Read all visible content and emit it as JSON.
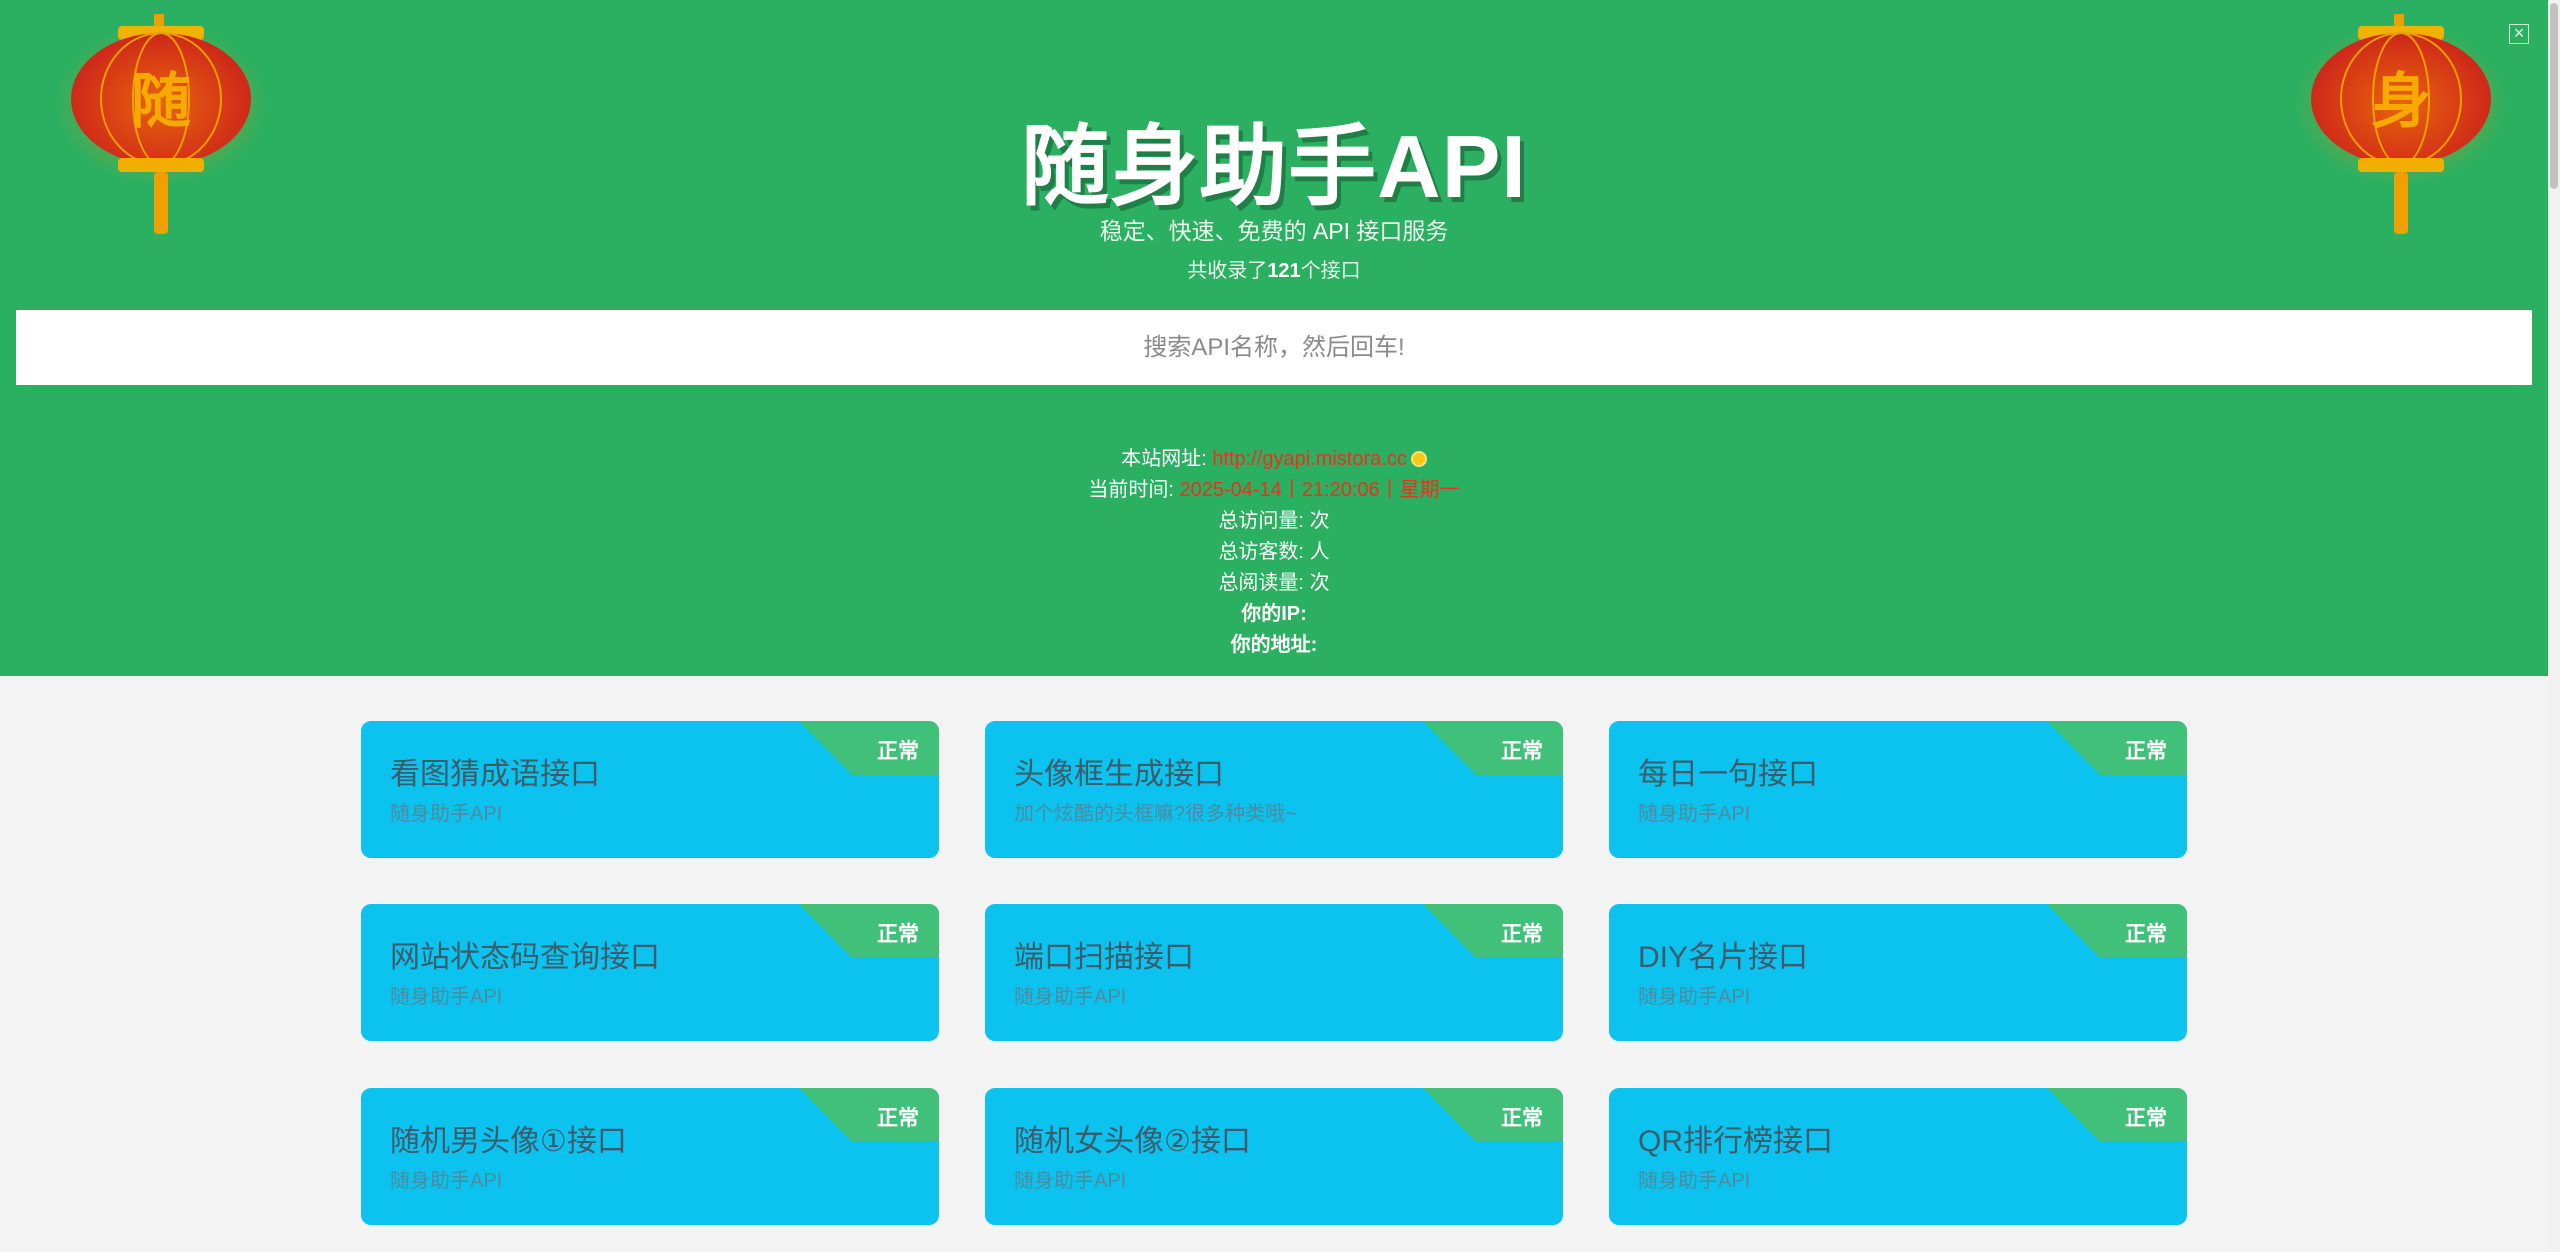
{
  "header": {
    "title": "随身助手API",
    "subtitle_pre": "稳定、快速、免费的 ",
    "subtitle_api": "API",
    "subtitle_post": " 接口服务",
    "count_pre": "共收录了",
    "count_num": "121",
    "count_post": "个接口",
    "lantern_left_char": "随",
    "lantern_right_char": "身"
  },
  "search": {
    "placeholder": "搜索API名称，然后回车!"
  },
  "info": {
    "site_label": "本站网址: ",
    "site_url": "http://gyapi.mistora.cc",
    "time_label": "当前时间: ",
    "time_value": "2025-04-14丨21:20:06丨星期一",
    "visits_label": "总访问量: ",
    "visits_unit": "次",
    "visitors_label": "总访客数: ",
    "visitors_unit": "人",
    "reads_label": "总阅读量: ",
    "reads_unit": "次",
    "ip_label": "你的IP:",
    "addr_label": "你的地址:"
  },
  "cards": [
    {
      "name": "看图猜成语接口",
      "desc": "随身助手API",
      "status": "正常"
    },
    {
      "name": "头像框生成接口",
      "desc": "加个炫酷的头框嘛?很多种类哦~",
      "status": "正常"
    },
    {
      "name": "每日一句接口",
      "desc": "随身助手API",
      "status": "正常"
    },
    {
      "name": "网站状态码查询接口",
      "desc": "随身助手API",
      "status": "正常"
    },
    {
      "name": "端口扫描接口",
      "desc": "随身助手API",
      "status": "正常"
    },
    {
      "name": "DIY名片接口",
      "desc": "随身助手API",
      "status": "正常"
    },
    {
      "name": "随机男头像①接口",
      "desc": "随身助手API",
      "status": "正常"
    },
    {
      "name": "随机女头像②接口",
      "desc": "随身助手API",
      "status": "正常"
    },
    {
      "name": "QR排行榜接口",
      "desc": "随身助手API",
      "status": "正常"
    }
  ],
  "colors": {
    "hero_bg": "#2bb062",
    "card_bg": "#0bc3ee",
    "badge_bg": "#41c07a",
    "accent_red": "#e8321a"
  }
}
